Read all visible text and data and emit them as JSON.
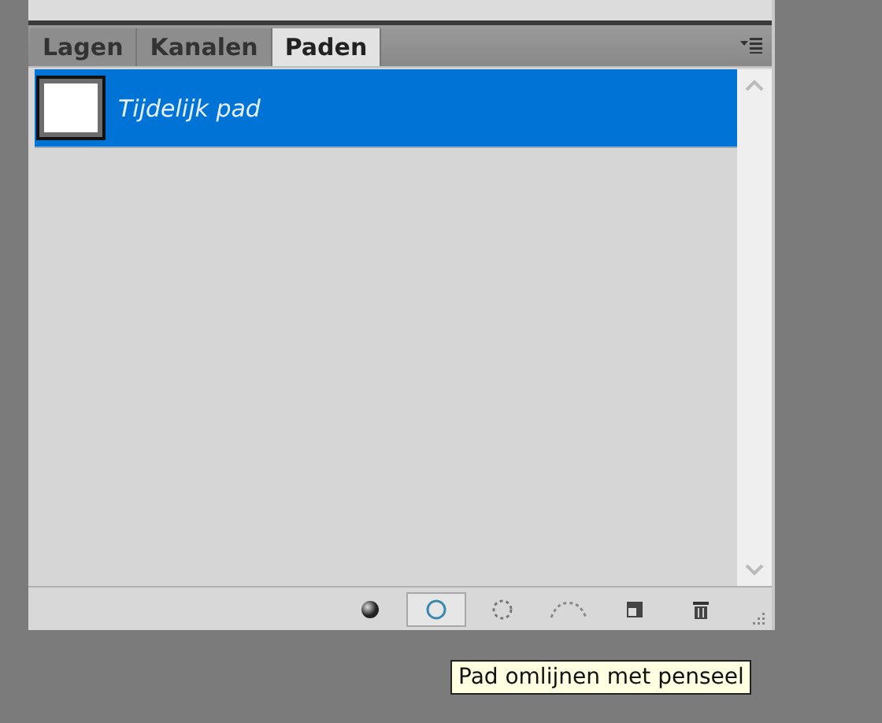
{
  "tabs": [
    {
      "label": "Lagen",
      "selected": false
    },
    {
      "label": "Kanalen",
      "selected": false
    },
    {
      "label": "Paden",
      "selected": true
    }
  ],
  "paths": [
    {
      "name": "Tijdelijk pad",
      "selected": true
    }
  ],
  "toolbar": [
    {
      "kind": "fill",
      "selected": false
    },
    {
      "kind": "stroke",
      "selected": true
    },
    {
      "kind": "selection",
      "selected": false
    },
    {
      "kind": "workpath",
      "selected": false
    },
    {
      "kind": "new",
      "selected": false
    },
    {
      "kind": "delete",
      "selected": false
    }
  ],
  "tooltip": "Pad omlijnen met penseel"
}
